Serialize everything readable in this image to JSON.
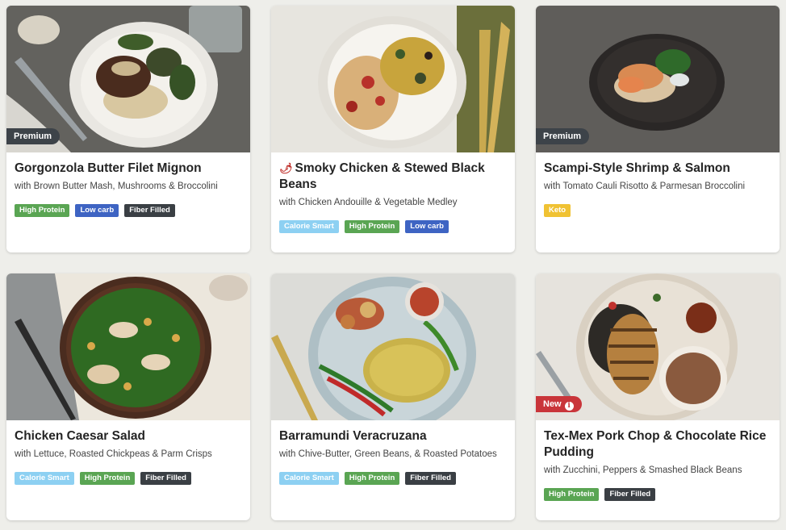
{
  "colors": {
    "high_protein": "#5aa553",
    "low_carb": "#3e64c3",
    "fiber_filled": "#3a3f44",
    "calorie_smart": "#8dd0f2",
    "keto": "#f0c233",
    "premium_flag": "#3d4349",
    "new_flag": "#c9353a"
  },
  "meals": [
    {
      "title": "Gorgonzola Butter Filet Mignon",
      "subtitle": "with Brown Butter Mash, Mushrooms & Broccolini",
      "flag": "Premium",
      "tags": [
        "High Protein",
        "Low carb",
        "Fiber Filled"
      ]
    },
    {
      "title": "Smoky Chicken & Stewed Black Beans",
      "subtitle": "with Chicken Andouille & Vegetable Medley",
      "icon": "chili-pepper-icon",
      "tags": [
        "Calorie Smart",
        "High Protein",
        "Low carb"
      ]
    },
    {
      "title": "Scampi-Style Shrimp & Salmon",
      "subtitle": "with Tomato Cauli Risotto & Parmesan Broccolini",
      "flag": "Premium",
      "tags": [
        "Keto"
      ]
    },
    {
      "title": "Chicken Caesar Salad",
      "subtitle": "with Lettuce, Roasted Chickpeas & Parm Crisps",
      "tags": [
        "Calorie Smart",
        "High Protein",
        "Fiber Filled"
      ]
    },
    {
      "title": "Barramundi Veracruzana",
      "subtitle": "with Chive-Butter, Green Beans, & Roasted Potatoes",
      "tags": [
        "Calorie Smart",
        "High Protein",
        "Fiber Filled"
      ]
    },
    {
      "title": "Tex-Mex Pork Chop & Chocolate Rice Pudding",
      "subtitle": "with Zucchini, Peppers & Smashed Black Beans",
      "flag": "New",
      "tags": [
        "High Protein",
        "Fiber Filled"
      ]
    }
  ]
}
